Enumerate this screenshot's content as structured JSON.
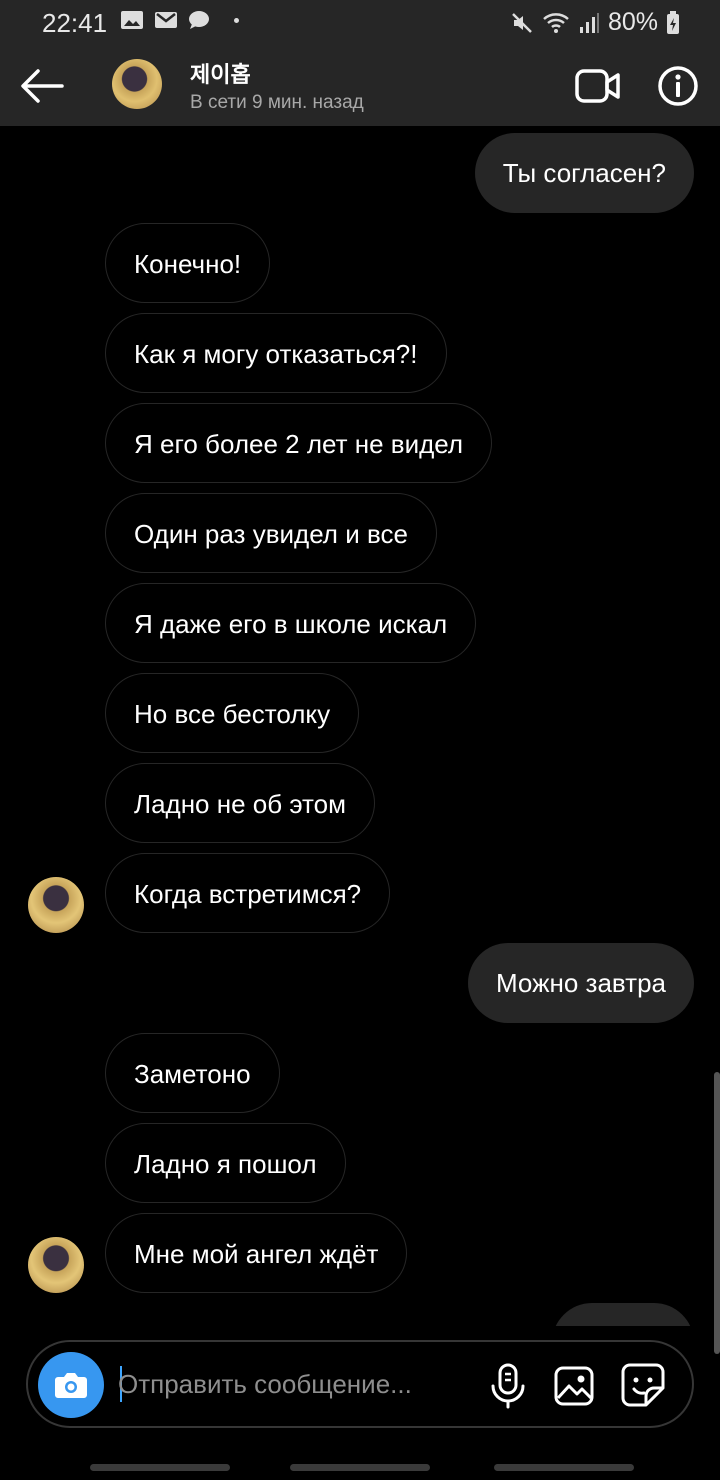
{
  "status_bar": {
    "time": "22:41",
    "battery": "80%"
  },
  "header": {
    "contact_name": "제이홉",
    "contact_status": "В сети 9 мин. назад"
  },
  "messages": [
    {
      "side": "out",
      "text": "Ты согласен?"
    },
    {
      "side": "in",
      "text": "Конечно!"
    },
    {
      "side": "in",
      "text": "Как я могу отказаться?!"
    },
    {
      "side": "in",
      "text": "Я его более 2 лет не видел"
    },
    {
      "side": "in",
      "text": "Один раз увидел и все"
    },
    {
      "side": "in",
      "text": "Я даже его в школе искал"
    },
    {
      "side": "in",
      "text": "Но все бестолку"
    },
    {
      "side": "in",
      "text": "Ладно не об этом"
    },
    {
      "side": "in",
      "text": "Когда встретимся?"
    },
    {
      "side": "out",
      "text": "Можно завтра"
    },
    {
      "side": "in",
      "text": "Заметоно"
    },
    {
      "side": "in",
      "text": "Ладно я пошол"
    },
    {
      "side": "in",
      "text": "Мне мой ангел ждёт"
    }
  ],
  "composer": {
    "placeholder": "Отправить сообщение..."
  },
  "colors": {
    "header_bg": "#262626",
    "outgoing_bubble": "#262626",
    "camera_button": "#3797f0"
  },
  "icons": [
    "back-arrow-icon",
    "video-call-icon",
    "info-icon",
    "camera-icon",
    "microphone-icon",
    "gallery-icon",
    "sticker-icon"
  ]
}
